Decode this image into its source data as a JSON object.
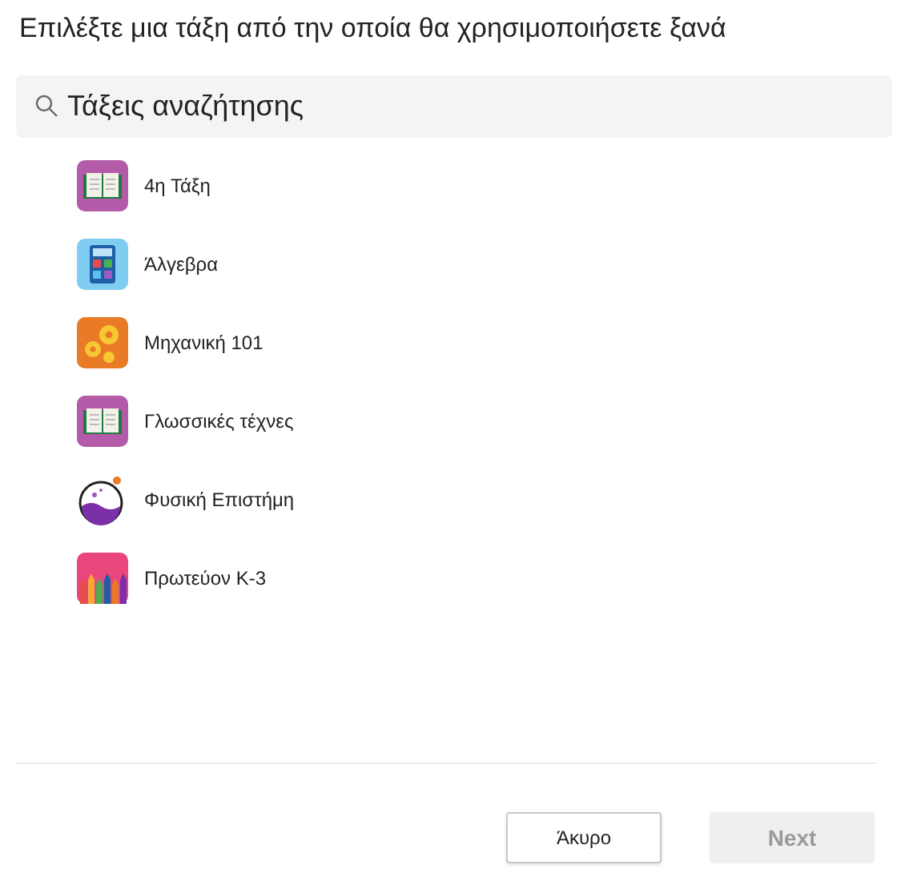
{
  "title": "Επιλέξτε μια τάξη από την οποία θα χρησιμοποιήσετε ξανά",
  "search": {
    "placeholder": "Τάξεις αναζήτησης"
  },
  "classes": [
    {
      "name": "4η Τάξη",
      "kind": "book"
    },
    {
      "name": "Άλγεβρα",
      "kind": "calculator"
    },
    {
      "name": "Μηχανική 101",
      "kind": "gears"
    },
    {
      "name": "Γλωσσικές τέχνες",
      "kind": "book"
    },
    {
      "name": "Φυσική Επιστήμη",
      "kind": "flask"
    },
    {
      "name": "Πρωτεύον K-3",
      "kind": "pencils"
    }
  ],
  "buttons": [
    {
      "label": "Άκυρο",
      "disabled": false
    },
    {
      "label": "Next",
      "disabled": true
    }
  ]
}
